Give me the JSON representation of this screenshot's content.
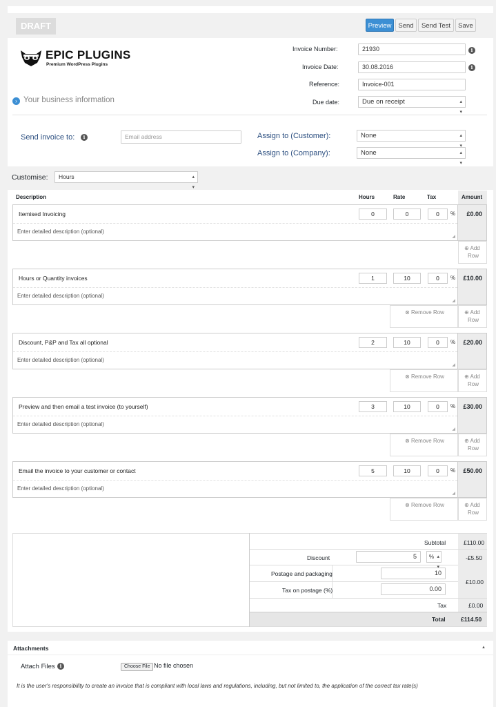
{
  "toolbar": {
    "draft_label": "DRAFT",
    "preview": "Preview",
    "send": "Send",
    "send_test": "Send Test",
    "save": "Save"
  },
  "brand": {
    "name": "EPIC PLUGINS",
    "tagline": "Premium WordPress Plugins",
    "business_info_link": "Your business information"
  },
  "invoice_meta": {
    "number_label": "Invoice Number:",
    "number_value": "21930",
    "date_label": "Invoice Date:",
    "date_value": "30.08.2016",
    "reference_label": "Reference:",
    "reference_value": "Invoice-001",
    "due_label": "Due date:",
    "due_value": "Due on receipt"
  },
  "recipient": {
    "send_to_label": "Send invoice to:",
    "email_placeholder": "Email address",
    "customer_label": "Assign to (Customer):",
    "customer_value": "None",
    "company_label": "Assign to (Company):",
    "company_value": "None"
  },
  "customise": {
    "label": "Customise:",
    "value": "Hours"
  },
  "table": {
    "headers": [
      "Description",
      "Hours",
      "Rate",
      "Tax",
      "Amount"
    ],
    "detail_placeholder": "Enter detailed description (optional)",
    "remove_row": "Remove Row",
    "add_row_1": "Add",
    "add_row_2": "Row",
    "pct_symbol": "%",
    "rows": [
      {
        "name": "Itemised Invoicing",
        "hours": "0",
        "rate": "0",
        "tax": "0",
        "amount": "£0.00"
      },
      {
        "name": "Hours or Quantity invoices",
        "hours": "1",
        "rate": "10",
        "tax": "0",
        "amount": "£10.00"
      },
      {
        "name": "Discount, P&P and Tax all optional",
        "hours": "2",
        "rate": "10",
        "tax": "0",
        "amount": "£20.00"
      },
      {
        "name": "Preview and then email a test invoice (to yourself)",
        "hours": "3",
        "rate": "10",
        "tax": "0",
        "amount": "£30.00"
      },
      {
        "name": "Email the invoice to your customer or contact",
        "hours": "5",
        "rate": "10",
        "tax": "0",
        "amount": "£50.00"
      }
    ]
  },
  "totals": {
    "subtotal_label": "Subtotal",
    "subtotal_value": "£110.00",
    "discount_label": "Discount",
    "discount_input": "5",
    "discount_type": "%",
    "discount_value": "-£5.50",
    "postage_label": "Postage and packaging",
    "postage_input": "10",
    "postage_tax_label": "Tax on postage (%)",
    "postage_tax_input": "0.00",
    "postage_value": "£10.00",
    "tax_label": "Tax",
    "tax_value": "£0.00",
    "total_label": "Total",
    "total_value": "£114.50"
  },
  "attachments": {
    "title": "Attachments",
    "attach_label": "Attach Files",
    "choose_file": "Choose File",
    "no_file": "No file chosen",
    "disclaimer": "It is the user's responsibility to create an invoice that is compliant with local laws and regulations, including, but not limited to, the application of the correct tax rate(s)"
  }
}
